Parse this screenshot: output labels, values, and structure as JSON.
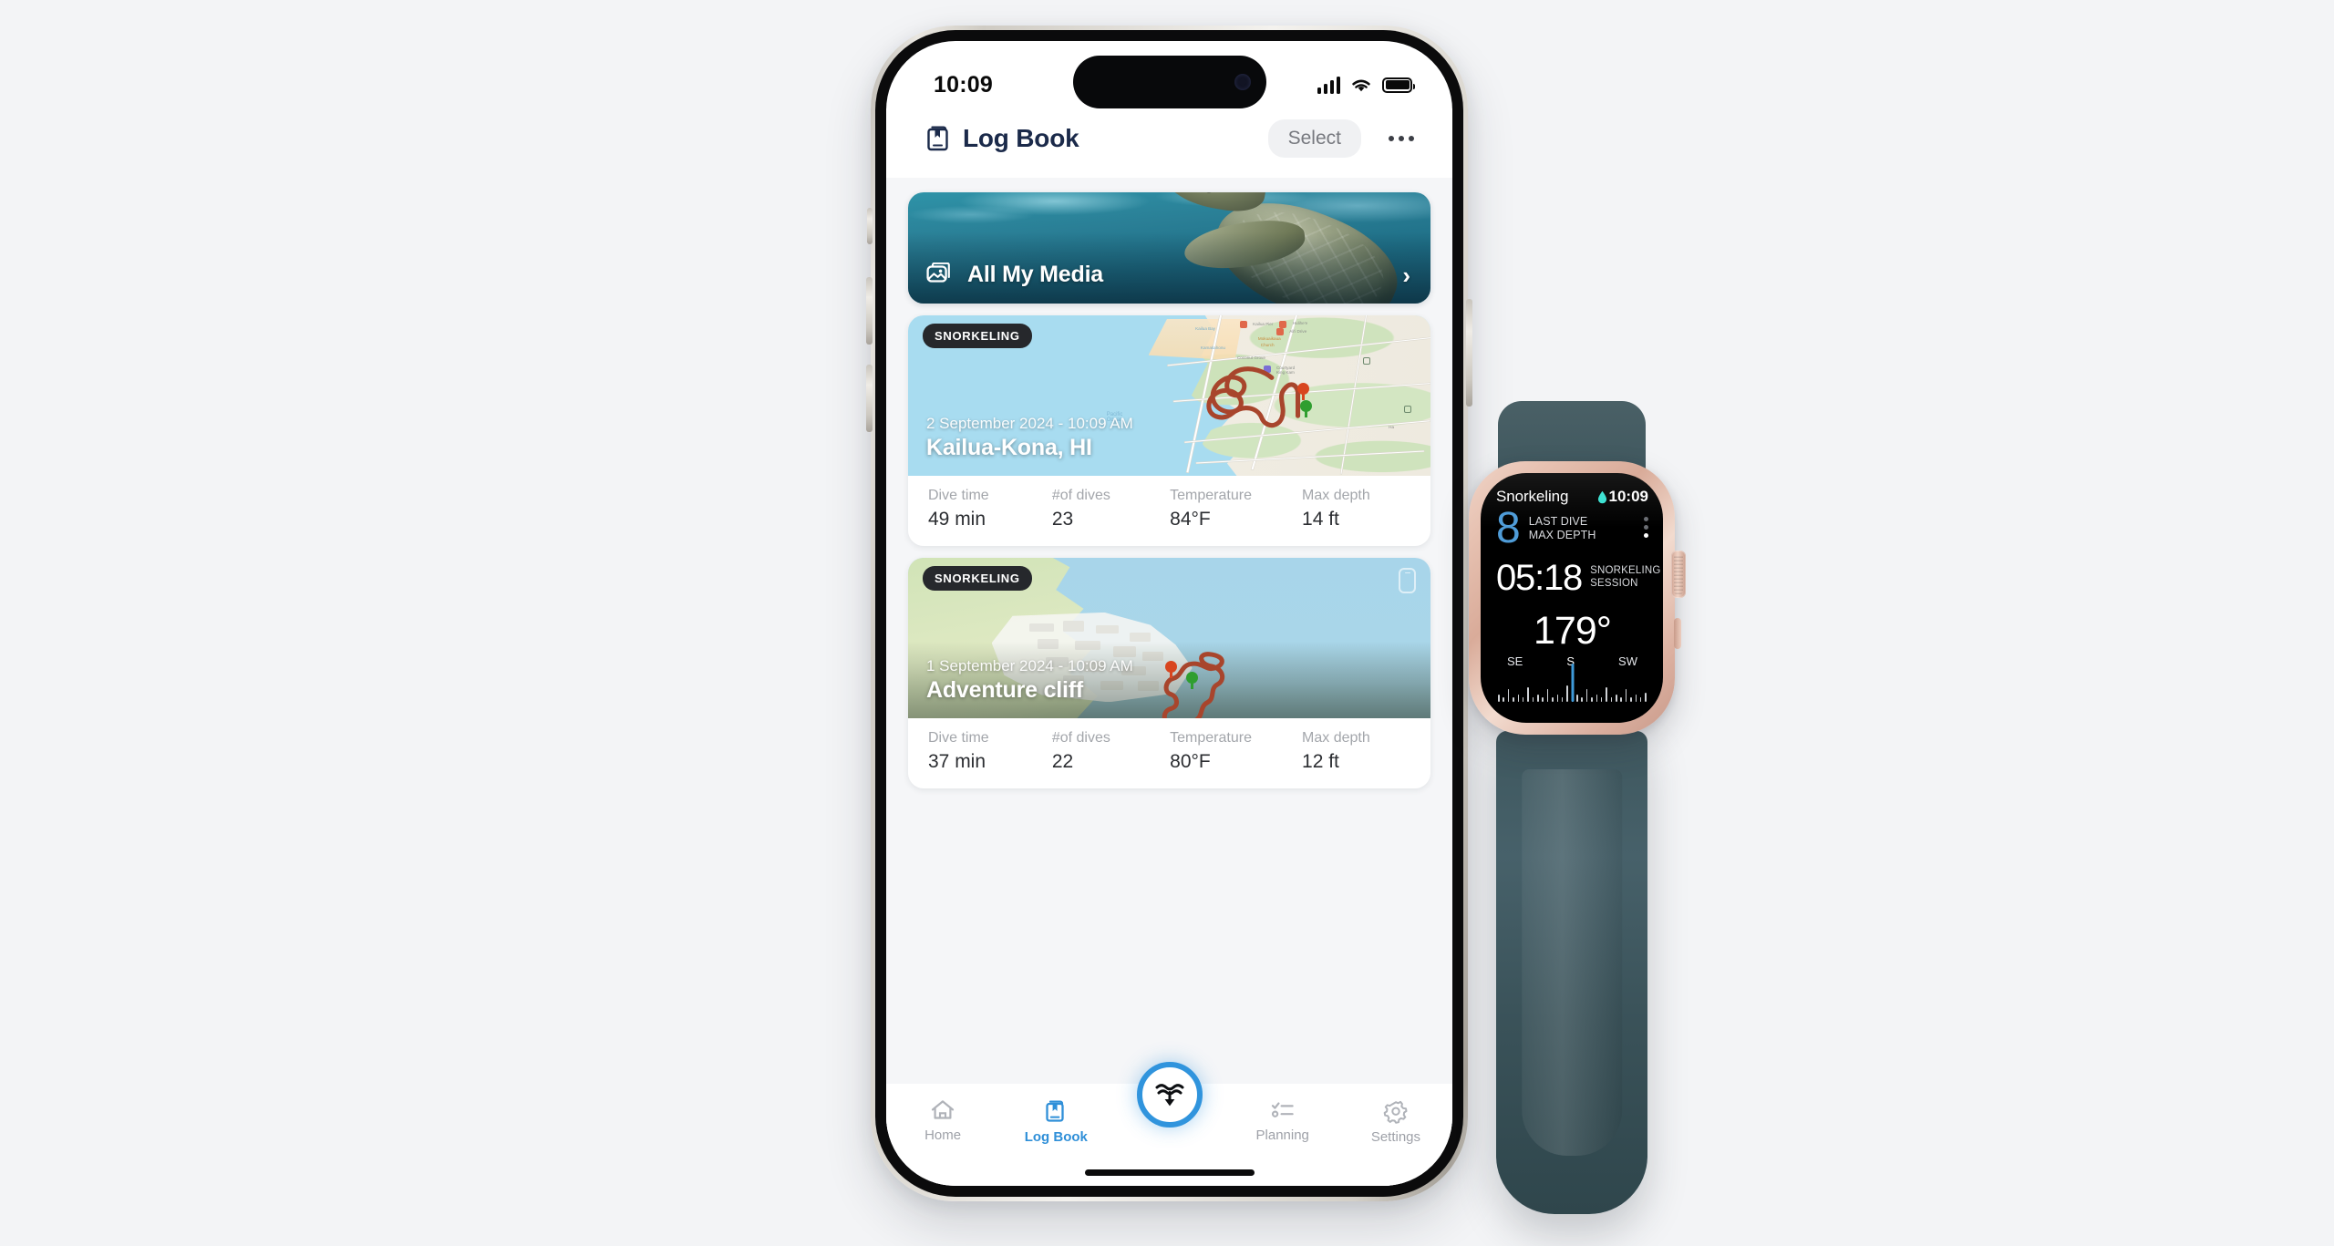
{
  "phone": {
    "status_bar": {
      "time": "10:09",
      "cellular_icon": "signal-bars-icon",
      "wifi_icon": "wifi-icon",
      "battery_icon": "battery-full-icon"
    },
    "nav": {
      "icon": "log-book-icon",
      "title": "Log Book",
      "select_label": "Select",
      "more_icon": "more-ellipsis-icon"
    },
    "media_banner": {
      "icon": "photo-stack-icon",
      "label": "All My Media",
      "chevron": "chevron-right-icon"
    },
    "dive_cards": [
      {
        "badge": "SNORKELING",
        "date": "2 September 2024 - 10:09 AM",
        "place": "Kailua-Kona, HI",
        "stats": [
          {
            "label": "Dive time",
            "value": "49 min"
          },
          {
            "label": "#of dives",
            "value": "23"
          },
          {
            "label": "Temperature",
            "value": "84°F"
          },
          {
            "label": "Max depth",
            "value": "14 ft"
          }
        ]
      },
      {
        "badge": "SNORKELING",
        "date": "1 September 2024 - 10:09 AM",
        "place": "Adventure cliff",
        "phone_icon": "device-icon",
        "stats": [
          {
            "label": "Dive time",
            "value": "37 min"
          },
          {
            "label": "#of dives",
            "value": "22"
          },
          {
            "label": "Temperature",
            "value": "80°F"
          },
          {
            "label": "Max depth",
            "value": "12 ft"
          }
        ]
      }
    ],
    "tab_bar": {
      "items": [
        {
          "label": "Home",
          "icon": "home-icon",
          "active": false
        },
        {
          "label": "Log Book",
          "icon": "log-book-icon",
          "active": true
        },
        {
          "label": "Planning",
          "icon": "checklist-icon",
          "active": false
        },
        {
          "label": "Settings",
          "icon": "gear-icon",
          "active": false
        }
      ],
      "fab_icon": "dive-down-icon"
    }
  },
  "watch": {
    "activity": "Snorkeling",
    "water_icon": "water-drop-icon",
    "time": "10:09",
    "last_dive_depth": "8",
    "last_dive_label_line1": "LAST DIVE",
    "last_dive_label_line2": "MAX DEPTH",
    "session_time": "05:18",
    "session_label_line1": "SNORKELING",
    "session_label_line2": "SESSION",
    "heading": "179°",
    "compass_directions": [
      "SE",
      "S",
      "SW"
    ]
  },
  "colors": {
    "background": "#f3f4f6",
    "accent_blue": "#3094dd",
    "nav_title": "#1b2a4a",
    "watch_depth_blue": "#4f9cd8",
    "water_drop_teal": "#35e0d0",
    "track_red": "#a8452c",
    "badge_dark": "#26282c"
  }
}
